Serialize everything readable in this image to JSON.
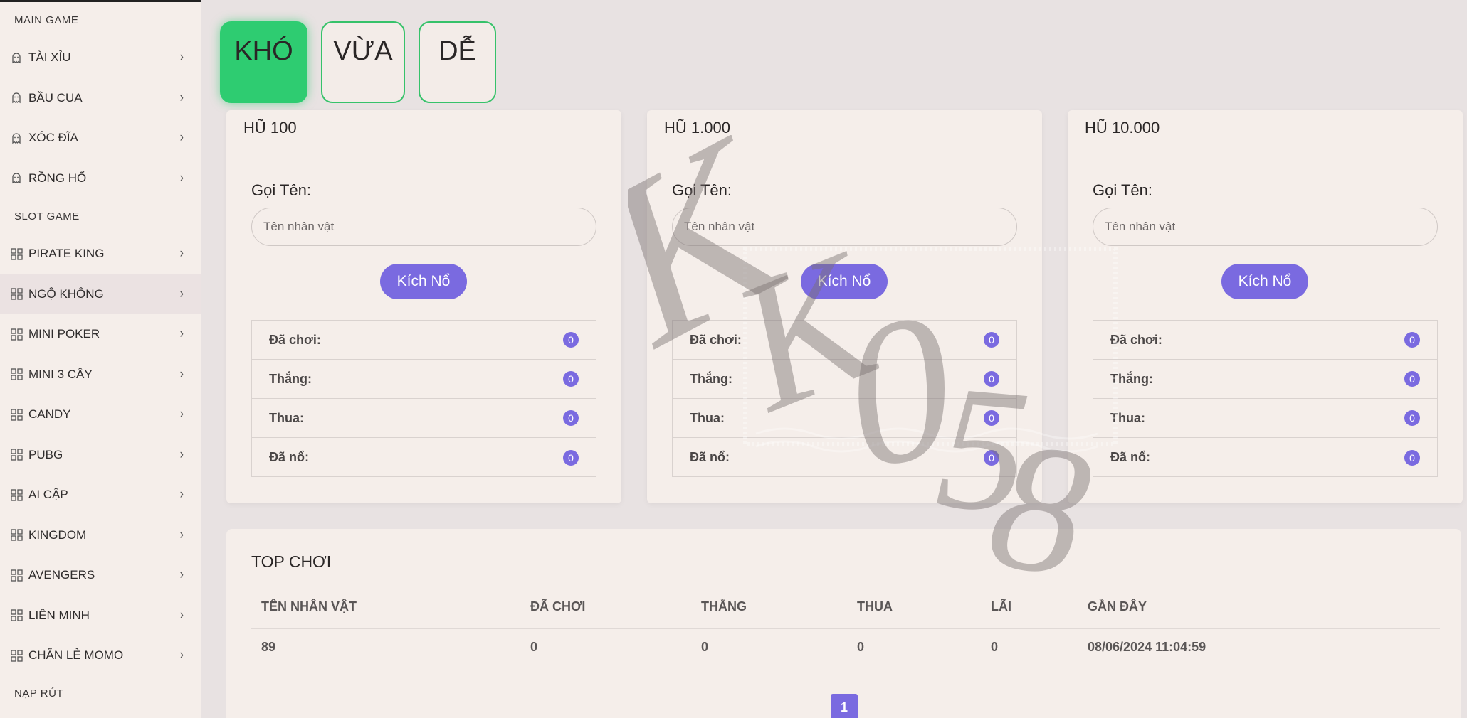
{
  "sidebar": {
    "sections": [
      {
        "title": "MAIN GAME",
        "items": [
          {
            "label": "TÀI XỈU",
            "icon": "ghost-icon"
          },
          {
            "label": "BẦU CUA",
            "icon": "ghost-icon"
          },
          {
            "label": "XÓC ĐĨA",
            "icon": "ghost-icon"
          },
          {
            "label": "RỒNG HỔ",
            "icon": "ghost-icon"
          }
        ]
      },
      {
        "title": "SLOT GAME",
        "items": [
          {
            "label": "PIRATE KING",
            "icon": "grid-icon"
          },
          {
            "label": "NGỘ KHÔNG",
            "icon": "grid-icon",
            "active": true
          },
          {
            "label": "MINI POKER",
            "icon": "grid-icon"
          },
          {
            "label": "MINI 3 CÂY",
            "icon": "grid-icon"
          },
          {
            "label": "CANDY",
            "icon": "grid-icon"
          },
          {
            "label": "PUBG",
            "icon": "grid-icon"
          },
          {
            "label": "AI CẬP",
            "icon": "grid-icon"
          },
          {
            "label": "KINGDOM",
            "icon": "grid-icon"
          },
          {
            "label": "AVENGERS",
            "icon": "grid-icon"
          },
          {
            "label": "LIÊN MINH",
            "icon": "grid-icon"
          },
          {
            "label": "CHẴN LẺ MOMO",
            "icon": "grid-icon"
          }
        ]
      },
      {
        "title": "NẠP RÚT",
        "items": []
      }
    ]
  },
  "tabs": [
    {
      "label": "KHÓ",
      "active": true
    },
    {
      "label": "VỪA",
      "active": false
    },
    {
      "label": "DỄ",
      "active": false
    }
  ],
  "cards": [
    {
      "title": "HŨ 100",
      "name_label": "Gọi Tên:",
      "name_placeholder": "Tên nhân vật",
      "button": "Kích Nổ",
      "stats": [
        {
          "label": "Đã chơi:",
          "value": "0"
        },
        {
          "label": "Thắng:",
          "value": "0"
        },
        {
          "label": "Thua:",
          "value": "0"
        },
        {
          "label": "Đã nổ:",
          "value": "0"
        }
      ]
    },
    {
      "title": "HŨ 1.000",
      "name_label": "Gọi Tên:",
      "name_placeholder": "Tên nhân vật",
      "button": "Kích Nổ",
      "stats": [
        {
          "label": "Đã chơi:",
          "value": "0"
        },
        {
          "label": "Thắng:",
          "value": "0"
        },
        {
          "label": "Thua:",
          "value": "0"
        },
        {
          "label": "Đã nổ:",
          "value": "0"
        }
      ]
    },
    {
      "title": "HŨ 10.000",
      "name_label": "Gọi Tên:",
      "name_placeholder": "Tên nhân vật",
      "button": "Kích Nổ",
      "stats": [
        {
          "label": "Đã chơi:",
          "value": "0"
        },
        {
          "label": "Thắng:",
          "value": "0"
        },
        {
          "label": "Thua:",
          "value": "0"
        },
        {
          "label": "Đã nổ:",
          "value": "0"
        }
      ]
    }
  ],
  "top": {
    "title": "TOP CHƠI",
    "columns": [
      "TÊN NHÂN VẬT",
      "ĐÃ CHƠI",
      "THẮNG",
      "THUA",
      "LÃI",
      "GẦN ĐÂY"
    ],
    "rows": [
      [
        "89",
        "0",
        "0",
        "0",
        "0",
        "08/06/2024 11:04:59"
      ]
    ],
    "page": "1"
  },
  "watermark": {
    "text": "KK058"
  },
  "colors": {
    "accent": "#7a6ae0",
    "tab_active": "#2ecc71",
    "panel": "#f5eeea",
    "background": "#e8e2e2"
  }
}
